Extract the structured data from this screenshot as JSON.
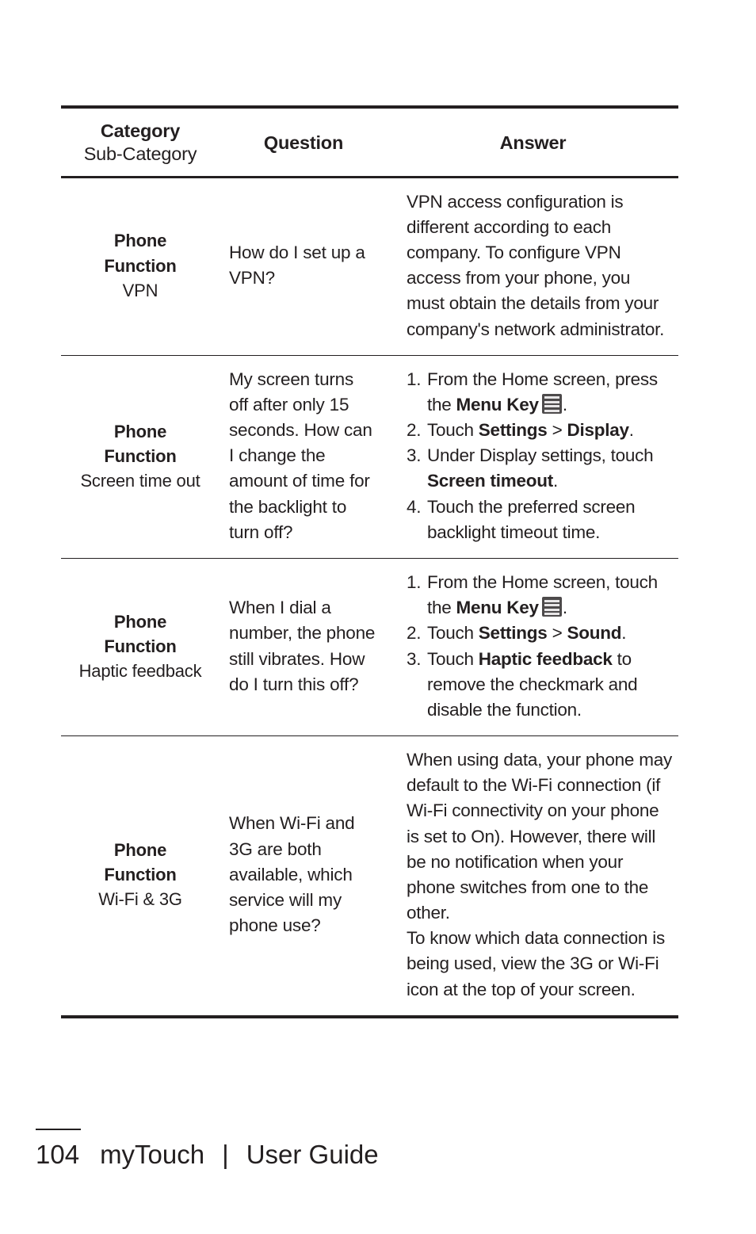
{
  "page": {
    "number": "104",
    "brand": "myTouch",
    "separator": "|",
    "doc_title": "User Guide"
  },
  "table": {
    "header": {
      "category_main": "Category",
      "category_sub": "Sub-Category",
      "question": "Question",
      "answer": "Answer"
    },
    "rows": [
      {
        "category_main_line1": "Phone",
        "category_main_line2": "Function",
        "category_sub": "VPN",
        "question": "How do I set up a VPN?",
        "answer_paragraphs": [
          "VPN access configuration is different according to each company. To configure VPN access from your phone, you must obtain the details from your company's network administrator."
        ],
        "answer_steps": []
      },
      {
        "category_main_line1": "Phone",
        "category_main_line2": "Function",
        "category_sub": "Screen time out",
        "question": "My screen turns off after only 15 seconds. How can I change the amount of time for the backlight to turn off?",
        "answer_paragraphs": [],
        "answer_steps": [
          {
            "num": "1.",
            "parts": [
              {
                "text": "From the Home screen, press the ",
                "bold": false
              },
              {
                "text": "Menu Key",
                "bold": true
              },
              {
                "icon": "menu-key-icon"
              },
              {
                "text": ".",
                "bold": false
              }
            ]
          },
          {
            "num": "2.",
            "parts": [
              {
                "text": "Touch ",
                "bold": false
              },
              {
                "text": "Settings",
                "bold": true
              },
              {
                "text": " > ",
                "bold": false
              },
              {
                "text": "Display",
                "bold": true
              },
              {
                "text": ".",
                "bold": false
              }
            ]
          },
          {
            "num": "3.",
            "parts": [
              {
                "text": "Under Display settings, touch ",
                "bold": false
              },
              {
                "text": "Screen timeout",
                "bold": true
              },
              {
                "text": ".",
                "bold": false
              }
            ]
          },
          {
            "num": "4.",
            "parts": [
              {
                "text": "Touch the preferred screen backlight timeout time.",
                "bold": false
              }
            ]
          }
        ]
      },
      {
        "category_main_line1": "Phone",
        "category_main_line2": "Function",
        "category_sub": "Haptic feedback",
        "question": "When I dial a number, the phone still vibrates. How do I turn this off?",
        "answer_paragraphs": [],
        "answer_steps": [
          {
            "num": "1.",
            "parts": [
              {
                "text": "From the Home screen, touch the ",
                "bold": false
              },
              {
                "text": "Menu Key",
                "bold": true
              },
              {
                "icon": "menu-key-icon"
              },
              {
                "text": ".",
                "bold": false
              }
            ]
          },
          {
            "num": "2.",
            "parts": [
              {
                "text": "Touch ",
                "bold": false
              },
              {
                "text": "Settings",
                "bold": true
              },
              {
                "text": " > ",
                "bold": false
              },
              {
                "text": "Sound",
                "bold": true
              },
              {
                "text": ".",
                "bold": false
              }
            ]
          },
          {
            "num": "3.",
            "parts": [
              {
                "text": "Touch ",
                "bold": false
              },
              {
                "text": "Haptic feedback",
                "bold": true
              },
              {
                "text": " to remove the checkmark and disable the function.",
                "bold": false
              }
            ]
          }
        ]
      },
      {
        "category_main_line1": "Phone",
        "category_main_line2": "Function",
        "category_sub": "Wi-Fi & 3G",
        "question": "When Wi-Fi and 3G are both available, which service will my phone use?",
        "answer_paragraphs": [
          "When using data, your phone may default to the Wi-Fi connection (if Wi-Fi connectivity on your phone is set to On). However, there will be no notification when your phone switches from one to the other.",
          "To know which data connection is being used, view the 3G or Wi-Fi icon at the top of your screen."
        ],
        "answer_steps": []
      }
    ]
  },
  "colors": {
    "text": "#231f20",
    "rule": "#231f20",
    "icon_bg": "#4d4a4b",
    "icon_bar": "#e8e6e7"
  }
}
